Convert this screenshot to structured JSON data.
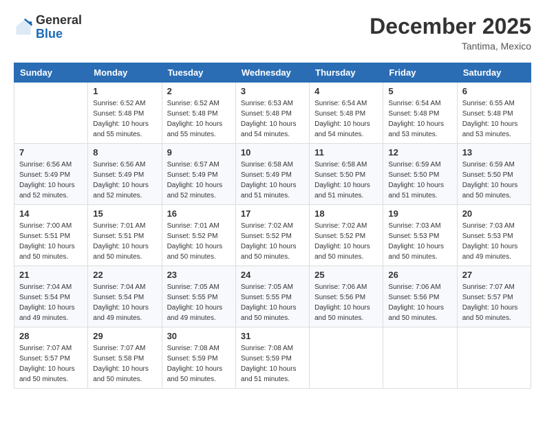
{
  "logo": {
    "general": "General",
    "blue": "Blue"
  },
  "header": {
    "month": "December 2025",
    "location": "Tantima, Mexico"
  },
  "weekdays": [
    "Sunday",
    "Monday",
    "Tuesday",
    "Wednesday",
    "Thursday",
    "Friday",
    "Saturday"
  ],
  "weeks": [
    [
      {
        "day": "",
        "info": ""
      },
      {
        "day": "1",
        "info": "Sunrise: 6:52 AM\nSunset: 5:48 PM\nDaylight: 10 hours\nand 55 minutes."
      },
      {
        "day": "2",
        "info": "Sunrise: 6:52 AM\nSunset: 5:48 PM\nDaylight: 10 hours\nand 55 minutes."
      },
      {
        "day": "3",
        "info": "Sunrise: 6:53 AM\nSunset: 5:48 PM\nDaylight: 10 hours\nand 54 minutes."
      },
      {
        "day": "4",
        "info": "Sunrise: 6:54 AM\nSunset: 5:48 PM\nDaylight: 10 hours\nand 54 minutes."
      },
      {
        "day": "5",
        "info": "Sunrise: 6:54 AM\nSunset: 5:48 PM\nDaylight: 10 hours\nand 53 minutes."
      },
      {
        "day": "6",
        "info": "Sunrise: 6:55 AM\nSunset: 5:48 PM\nDaylight: 10 hours\nand 53 minutes."
      }
    ],
    [
      {
        "day": "7",
        "info": "Sunrise: 6:56 AM\nSunset: 5:49 PM\nDaylight: 10 hours\nand 52 minutes."
      },
      {
        "day": "8",
        "info": "Sunrise: 6:56 AM\nSunset: 5:49 PM\nDaylight: 10 hours\nand 52 minutes."
      },
      {
        "day": "9",
        "info": "Sunrise: 6:57 AM\nSunset: 5:49 PM\nDaylight: 10 hours\nand 52 minutes."
      },
      {
        "day": "10",
        "info": "Sunrise: 6:58 AM\nSunset: 5:49 PM\nDaylight: 10 hours\nand 51 minutes."
      },
      {
        "day": "11",
        "info": "Sunrise: 6:58 AM\nSunset: 5:50 PM\nDaylight: 10 hours\nand 51 minutes."
      },
      {
        "day": "12",
        "info": "Sunrise: 6:59 AM\nSunset: 5:50 PM\nDaylight: 10 hours\nand 51 minutes."
      },
      {
        "day": "13",
        "info": "Sunrise: 6:59 AM\nSunset: 5:50 PM\nDaylight: 10 hours\nand 50 minutes."
      }
    ],
    [
      {
        "day": "14",
        "info": "Sunrise: 7:00 AM\nSunset: 5:51 PM\nDaylight: 10 hours\nand 50 minutes."
      },
      {
        "day": "15",
        "info": "Sunrise: 7:01 AM\nSunset: 5:51 PM\nDaylight: 10 hours\nand 50 minutes."
      },
      {
        "day": "16",
        "info": "Sunrise: 7:01 AM\nSunset: 5:52 PM\nDaylight: 10 hours\nand 50 minutes."
      },
      {
        "day": "17",
        "info": "Sunrise: 7:02 AM\nSunset: 5:52 PM\nDaylight: 10 hours\nand 50 minutes."
      },
      {
        "day": "18",
        "info": "Sunrise: 7:02 AM\nSunset: 5:52 PM\nDaylight: 10 hours\nand 50 minutes."
      },
      {
        "day": "19",
        "info": "Sunrise: 7:03 AM\nSunset: 5:53 PM\nDaylight: 10 hours\nand 50 minutes."
      },
      {
        "day": "20",
        "info": "Sunrise: 7:03 AM\nSunset: 5:53 PM\nDaylight: 10 hours\nand 49 minutes."
      }
    ],
    [
      {
        "day": "21",
        "info": "Sunrise: 7:04 AM\nSunset: 5:54 PM\nDaylight: 10 hours\nand 49 minutes."
      },
      {
        "day": "22",
        "info": "Sunrise: 7:04 AM\nSunset: 5:54 PM\nDaylight: 10 hours\nand 49 minutes."
      },
      {
        "day": "23",
        "info": "Sunrise: 7:05 AM\nSunset: 5:55 PM\nDaylight: 10 hours\nand 49 minutes."
      },
      {
        "day": "24",
        "info": "Sunrise: 7:05 AM\nSunset: 5:55 PM\nDaylight: 10 hours\nand 50 minutes."
      },
      {
        "day": "25",
        "info": "Sunrise: 7:06 AM\nSunset: 5:56 PM\nDaylight: 10 hours\nand 50 minutes."
      },
      {
        "day": "26",
        "info": "Sunrise: 7:06 AM\nSunset: 5:56 PM\nDaylight: 10 hours\nand 50 minutes."
      },
      {
        "day": "27",
        "info": "Sunrise: 7:07 AM\nSunset: 5:57 PM\nDaylight: 10 hours\nand 50 minutes."
      }
    ],
    [
      {
        "day": "28",
        "info": "Sunrise: 7:07 AM\nSunset: 5:57 PM\nDaylight: 10 hours\nand 50 minutes."
      },
      {
        "day": "29",
        "info": "Sunrise: 7:07 AM\nSunset: 5:58 PM\nDaylight: 10 hours\nand 50 minutes."
      },
      {
        "day": "30",
        "info": "Sunrise: 7:08 AM\nSunset: 5:59 PM\nDaylight: 10 hours\nand 50 minutes."
      },
      {
        "day": "31",
        "info": "Sunrise: 7:08 AM\nSunset: 5:59 PM\nDaylight: 10 hours\nand 51 minutes."
      },
      {
        "day": "",
        "info": ""
      },
      {
        "day": "",
        "info": ""
      },
      {
        "day": "",
        "info": ""
      }
    ]
  ]
}
